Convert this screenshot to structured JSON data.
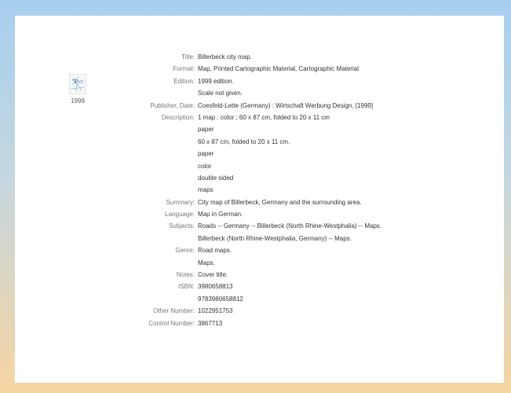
{
  "thumbnail": {
    "icon": "map-thumbnail-icon",
    "year": "1999"
  },
  "fields": [
    {
      "label": "Title:",
      "values": [
        "Billerbeck city map."
      ]
    },
    {
      "label": "Format:",
      "values": [
        "Map, Printed Cartographic Material, Cartographic Material"
      ]
    },
    {
      "label": "Edition:",
      "values": [
        "1999 edition.",
        "Scale not given."
      ]
    },
    {
      "label": "Publisher, Date:",
      "values": [
        "Coesfeld-Lette (Germany) : Wirtschaft Werbung Design, [1999]"
      ]
    },
    {
      "label": "Description:",
      "values": [
        "1 map : color ; 60 x 87 cm, folded to 20 x 11 cm",
        "paper",
        "60 x 87 cm, folded to 20 x 11 cm.",
        "paper",
        "color",
        "double sided",
        "maps"
      ]
    },
    {
      "label": "Summary:",
      "values": [
        "City map of Billerbeck, Germany and the surrounding area."
      ]
    },
    {
      "label": "Language:",
      "values": [
        "Map in German."
      ]
    },
    {
      "label": "Subjects:",
      "values": [
        "Roads -- Germany -- Billerbeck (North Rhine-Westphalia) -- Maps.",
        "Billerbeck (North Rhine-Westphalia, Germany) -- Maps."
      ]
    },
    {
      "label": "Genre:",
      "values": [
        "Road maps.",
        "Maps."
      ]
    },
    {
      "label": "Notes:",
      "values": [
        "Cover title."
      ]
    },
    {
      "label": "ISBN:",
      "values": [
        "3980658813",
        "9783980658812"
      ]
    },
    {
      "label": "Other Number:",
      "values": [
        "1022951753"
      ]
    },
    {
      "label": "Control Number:",
      "values": [
        "3867713"
      ]
    }
  ]
}
